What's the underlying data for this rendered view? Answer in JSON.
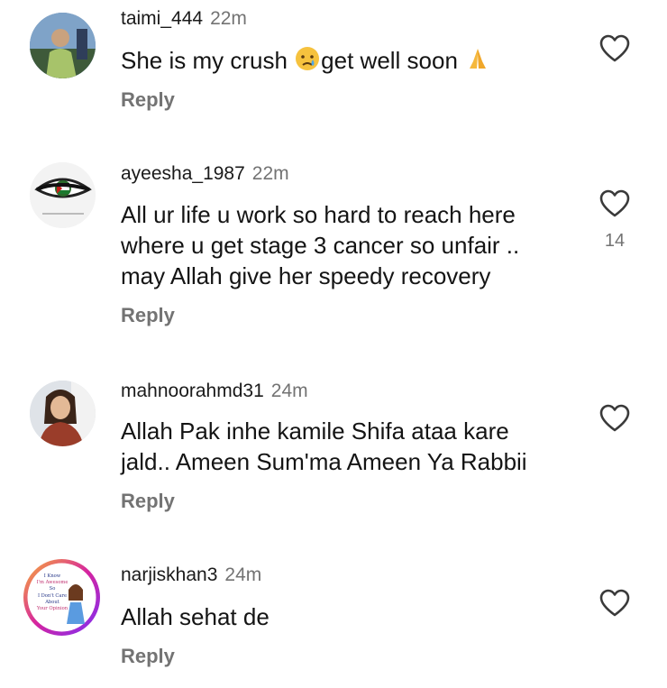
{
  "comments": [
    {
      "username": "taimi_444",
      "time": "22m",
      "text_before": "She is my crush ",
      "text_middle": "get well soon ",
      "text_after": "",
      "reply_label": "Reply",
      "likes": "",
      "emojis": [
        "crying-face",
        "folded-hands"
      ]
    },
    {
      "username": "ayeesha_1987",
      "time": "22m",
      "lines": [
        "All ur life u work so hard to reach here",
        "where u get stage 3 cancer so unfair ..",
        "may Allah give her speedy recovery"
      ],
      "reply_label": "Reply",
      "likes": "14"
    },
    {
      "username": "mahnoorahmd31",
      "time": "24m",
      "lines": [
        "Allah Pak inhe kamile Shifa ataa kare",
        "jald.. Ameen Sum'ma Ameen Ya Rabbii"
      ],
      "reply_label": "Reply",
      "likes": ""
    },
    {
      "username": "narjiskhan3",
      "time": "24m",
      "lines": [
        "Allah sehat de"
      ],
      "reply_label": "Reply",
      "likes": "",
      "avatar_text": [
        "I Know",
        "I'm Awesome",
        "So",
        "I Don't Care",
        "About",
        "Your Opinion"
      ]
    }
  ],
  "colors": {
    "text": "#141414",
    "muted": "#737373",
    "avatar_ring": "#d6249f"
  }
}
